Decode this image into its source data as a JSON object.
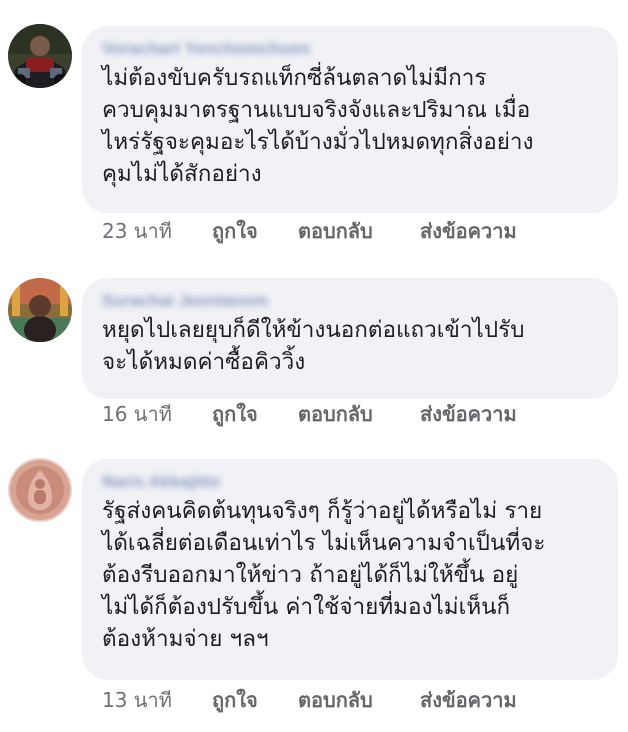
{
  "comments": [
    {
      "author": "Vorachart Yenchomchuen",
      "text": "ไม่ต้องขับครับรถแท็กซี่ล้นตลาดไม่มีการ\nควบคุมมาตรฐานแบบจริงจังและปริมาณ เมื่อ\nไหร่รัฐจะคุมอะไรได้บ้างมั่วไปหมดทุกสิ่งอย่าง\nคุมไม่ได้สักอย่าง",
      "time": "23 นาที",
      "like": "ถูกใจ",
      "reply": "ตอบกลับ",
      "message": "ส่งข้อความ"
    },
    {
      "author": "Surachai Jeentanom",
      "text": "หยุดไปเลยยุบก็ดีให้ข้างนอกต่อแถวเข้าไปรับ\nจะได้หมดค่าซื้อคิววิ้ง",
      "time": "16 นาที",
      "like": "ถูกใจ",
      "reply": "ตอบกลับ",
      "message": "ส่งข้อความ"
    },
    {
      "author": "Naris Akkajitto",
      "text": "รัฐส่งคนคิดต้นทุนจริงๆ ก็รู้ว่าอยู่ได้หรือไม่ ราย\nได้เฉลี่ยต่อเดือนเท่าไร ไม่เห็นความจำเป็นที่จะ\nต้องรีบออกมาให้ข่าว ถ้าอยู่ได้ก็ไม่ให้ขึ้น อยู่\nไม่ได้ก็ต้องปรับขึ้น ค่าใช้จ่ายที่มองไม่เห็นก็\nต้องห้ามจ่าย ฯลฯ",
      "time": "13 นาที",
      "like": "ถูกใจ",
      "reply": "ตอบกลับ",
      "message": "ส่งข้อความ"
    }
  ]
}
